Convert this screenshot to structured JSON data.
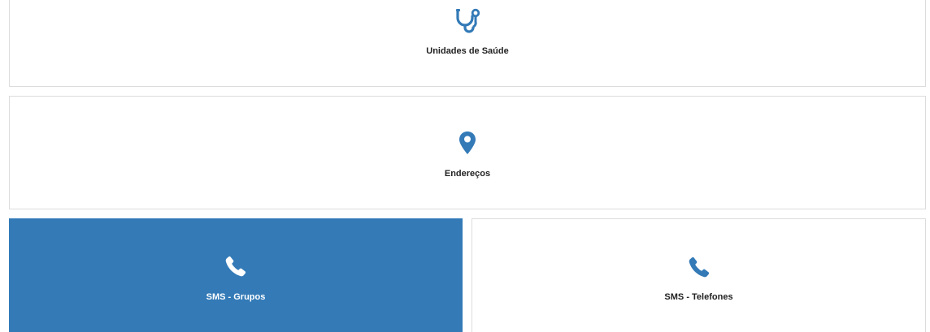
{
  "colors": {
    "accent": "#337ab7",
    "tile_background": "#ffffff",
    "tile_border": "#dcdcdc",
    "label_text": "#222222",
    "active_label_text": "#ffffff"
  },
  "tiles": [
    {
      "label": "Unidades de Saúde",
      "icon": "stethoscope-icon",
      "active": false
    },
    {
      "label": "Endereços",
      "icon": "map-marker-icon",
      "active": false
    },
    {
      "label": "SMS - Grupos",
      "icon": "phone-icon",
      "active": true
    },
    {
      "label": "SMS - Telefones",
      "icon": "phone-icon",
      "active": false
    }
  ]
}
